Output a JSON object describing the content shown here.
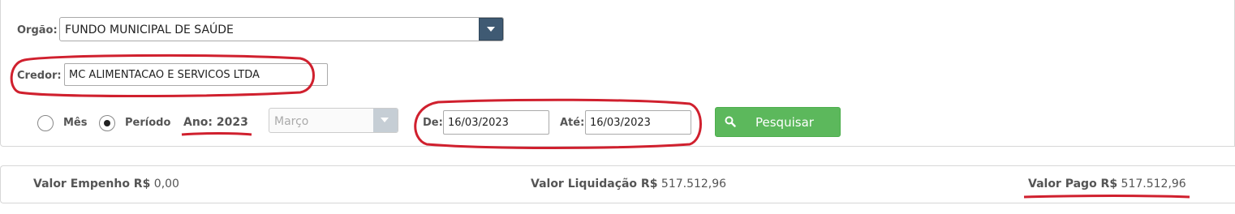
{
  "filters": {
    "orgao": {
      "label": "Orgão:",
      "value": "FUNDO MUNICIPAL DE SAÚDE"
    },
    "credor": {
      "label": "Credor:",
      "value": "MC ALIMENTACAO E SERVICOS LTDA"
    },
    "mes_label": "Mês",
    "periodo_label": "Período",
    "selected_mode": "Período",
    "ano_label": "Ano: 2023",
    "month_select": {
      "value": "Março",
      "disabled": true
    },
    "de": {
      "label": "De:",
      "value": "16/03/2023"
    },
    "ate": {
      "label": "Até:",
      "value": "16/03/2023"
    },
    "search_button": {
      "label": "Pesquisar",
      "icon": "search-icon",
      "color": "#5cb85c"
    }
  },
  "totals": {
    "empenho": {
      "label": "Valor Empenho R$",
      "value": "0,00"
    },
    "liquidacao": {
      "label": "Valor Liquidação R$",
      "value": "517.512,96"
    },
    "pago": {
      "label": "Valor Pago R$",
      "value": "517.512,96"
    }
  },
  "colors": {
    "annotation": "#d0202e",
    "select_arrow": "#3f5a73",
    "button_green": "#5cb85c"
  }
}
